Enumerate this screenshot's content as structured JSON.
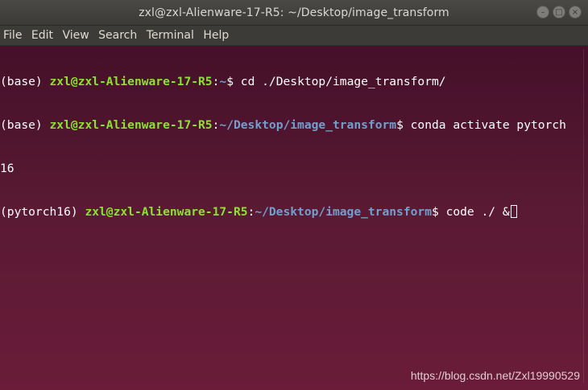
{
  "window": {
    "title": "zxl@zxl-Alienware-17-R5: ~/Desktop/image_transform",
    "buttons": {
      "minimize": "–",
      "maximize": "□",
      "close": "×"
    }
  },
  "menu": {
    "items": [
      "File",
      "Edit",
      "View",
      "Search",
      "Terminal",
      "Help"
    ]
  },
  "terminal": {
    "lines": [
      {
        "prefix": "(base) ",
        "user": "zxl@zxl-Alienware-17-R5",
        "sep": ":",
        "path": "~",
        "prompt": "$ ",
        "command": "cd ./Desktop/image_transform/"
      },
      {
        "prefix": "(base) ",
        "user": "zxl@zxl-Alienware-17-R5",
        "sep": ":",
        "path": "~/Desktop/image_transform",
        "prompt": "$ ",
        "command": "conda activate pytorch",
        "wrap": "16"
      },
      {
        "prefix": "(pytorch16) ",
        "user": "zxl@zxl-Alienware-17-R5",
        "sep": ":",
        "path": "~/Desktop/image_transform",
        "prompt": "$ ",
        "command": "code ./ &"
      }
    ]
  },
  "watermark": "https://blog.csdn.net/Zxl19990529",
  "colors": {
    "background": "#5a1a33",
    "user": "#8ae234",
    "path": "#729fcf",
    "text": "#ffffff",
    "titlebar": "#3b3a36"
  }
}
